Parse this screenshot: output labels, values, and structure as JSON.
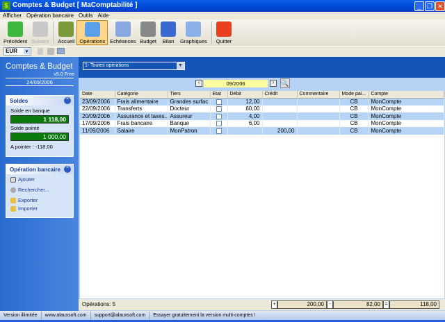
{
  "window": {
    "title": "Comptes & Budget [ MaComptabilité ]"
  },
  "menu": [
    "Afficher",
    "Opération bancaire",
    "Outils",
    "Aide"
  ],
  "toolbar": [
    {
      "label": "Précédent",
      "icon": "back-arrow-icon",
      "color": "#3cb83c",
      "enabled": true
    },
    {
      "label": "Suivant",
      "icon": "forward-arrow-icon",
      "color": "#c8c8c8",
      "enabled": false
    },
    {
      "label": "Accueil",
      "icon": "home-icon",
      "color": "#7a9a3a",
      "enabled": true
    },
    {
      "label": "Opérations",
      "icon": "operations-notebook-icon",
      "color": "#5aa0e8",
      "enabled": true,
      "active": true
    },
    {
      "label": "Echéances",
      "icon": "calendar-icon",
      "color": "#8aa8e0",
      "enabled": true
    },
    {
      "label": "Budget",
      "icon": "budget-clock-icon",
      "color": "#888",
      "enabled": true
    },
    {
      "label": "Bilan",
      "icon": "bilan-check-icon",
      "color": "#3a6ad0",
      "enabled": true
    },
    {
      "label": "Graphiques",
      "icon": "pie-chart-icon",
      "color": "#8ab0e8",
      "enabled": true
    },
    {
      "label": "Quitter",
      "icon": "power-icon",
      "color": "#e84020",
      "enabled": true
    }
  ],
  "currency": "EUR",
  "sidebar": {
    "app_name": "Comptes & Budget",
    "version": "v5.0 Free",
    "date": "24/09/2006",
    "soldes": {
      "title": "Soldes",
      "bank_label": "Solde en banque",
      "bank_value": "1 118,00",
      "pointed_label": "Solde pointé",
      "pointed_value": "1 000,00",
      "to_point": "A pointer : -118,00"
    },
    "operations": {
      "title": "Opération bancaire",
      "items": [
        "Ajouter",
        "Rechercher...",
        "Exporter",
        "Importer"
      ]
    }
  },
  "filter": {
    "selected": "1- Toutes opérations"
  },
  "period": "09/2006",
  "columns": [
    "Date",
    "Catégorie",
    "Tiers",
    "Etat",
    "Débit",
    "Crédit",
    "Commentaire",
    "Mode pai...",
    "Compte"
  ],
  "rows": [
    [
      "23/09/2006",
      "Frais alimentaire",
      "Grandes surfac",
      "",
      "12,00",
      "",
      "",
      "CB",
      "MonCompte"
    ],
    [
      "22/09/2006",
      "Transferts",
      "Docteur",
      "",
      "60,00",
      "",
      "",
      "CB",
      "MonCompte"
    ],
    [
      "20/09/2006",
      "Assurance et taxes...",
      "Assureur",
      "",
      "4,00",
      "",
      "",
      "CB",
      "MonCompte"
    ],
    [
      "17/09/2006",
      "Frais bancaire",
      "Banque",
      "",
      "6,00",
      "",
      "",
      "CB",
      "MonCompte"
    ],
    [
      "11/09/2006",
      "Salaire",
      "MonPatron",
      "",
      "",
      "200,00",
      "",
      "CB",
      "MonCompte"
    ]
  ],
  "footer": {
    "count": "Opérations: 5",
    "credit_sign": "+",
    "credit": "200,00",
    "debit_sign": "-",
    "debit": "82,00",
    "total_sign": "=",
    "total": "118,00"
  },
  "status": [
    "Version illimitée",
    "www.alauxsoft.com",
    "support@alauxsoft.com",
    "Essayer gratuitement la version multi-comptes !"
  ]
}
